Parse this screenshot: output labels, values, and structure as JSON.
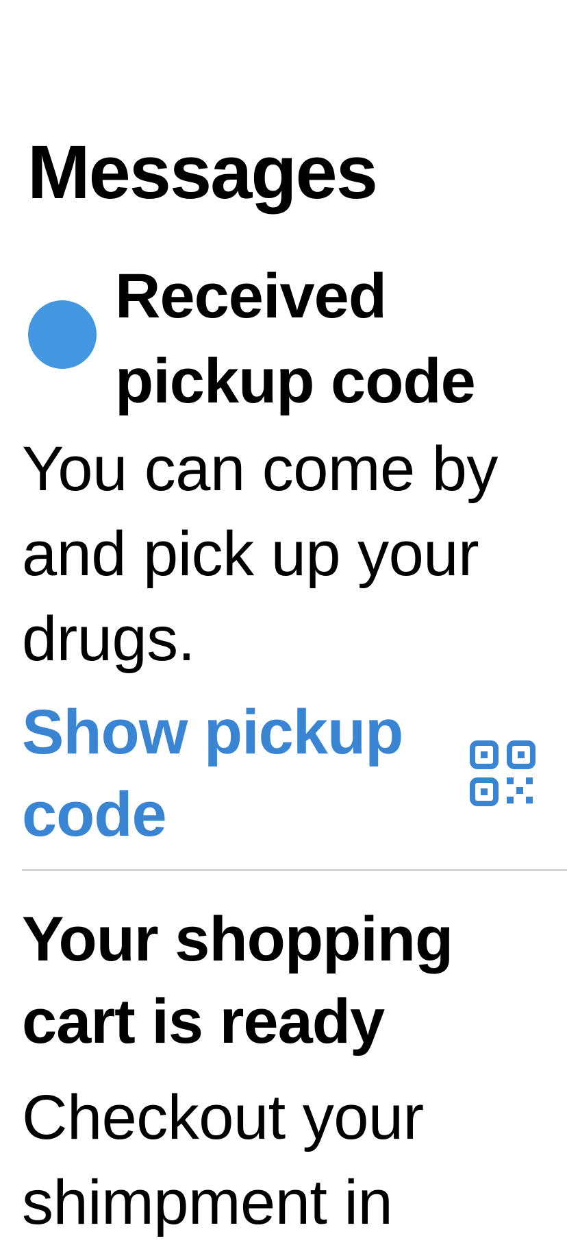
{
  "page": {
    "title": "Messages"
  },
  "messages": [
    {
      "title": "Received pickup code",
      "body": "You can come by and pick up your drugs.",
      "unread": true,
      "action_label": "Show pickup code",
      "action_icon": "qr-code-icon"
    },
    {
      "title": "Your shopping cart is ready",
      "body": "Checkout your shimpment in",
      "unread": false
    }
  ],
  "colors": {
    "accent": "#3a85d3",
    "unread_dot": "#4396e0",
    "divider": "#c8c8c8",
    "text": "#000000",
    "background": "#ffffff"
  }
}
